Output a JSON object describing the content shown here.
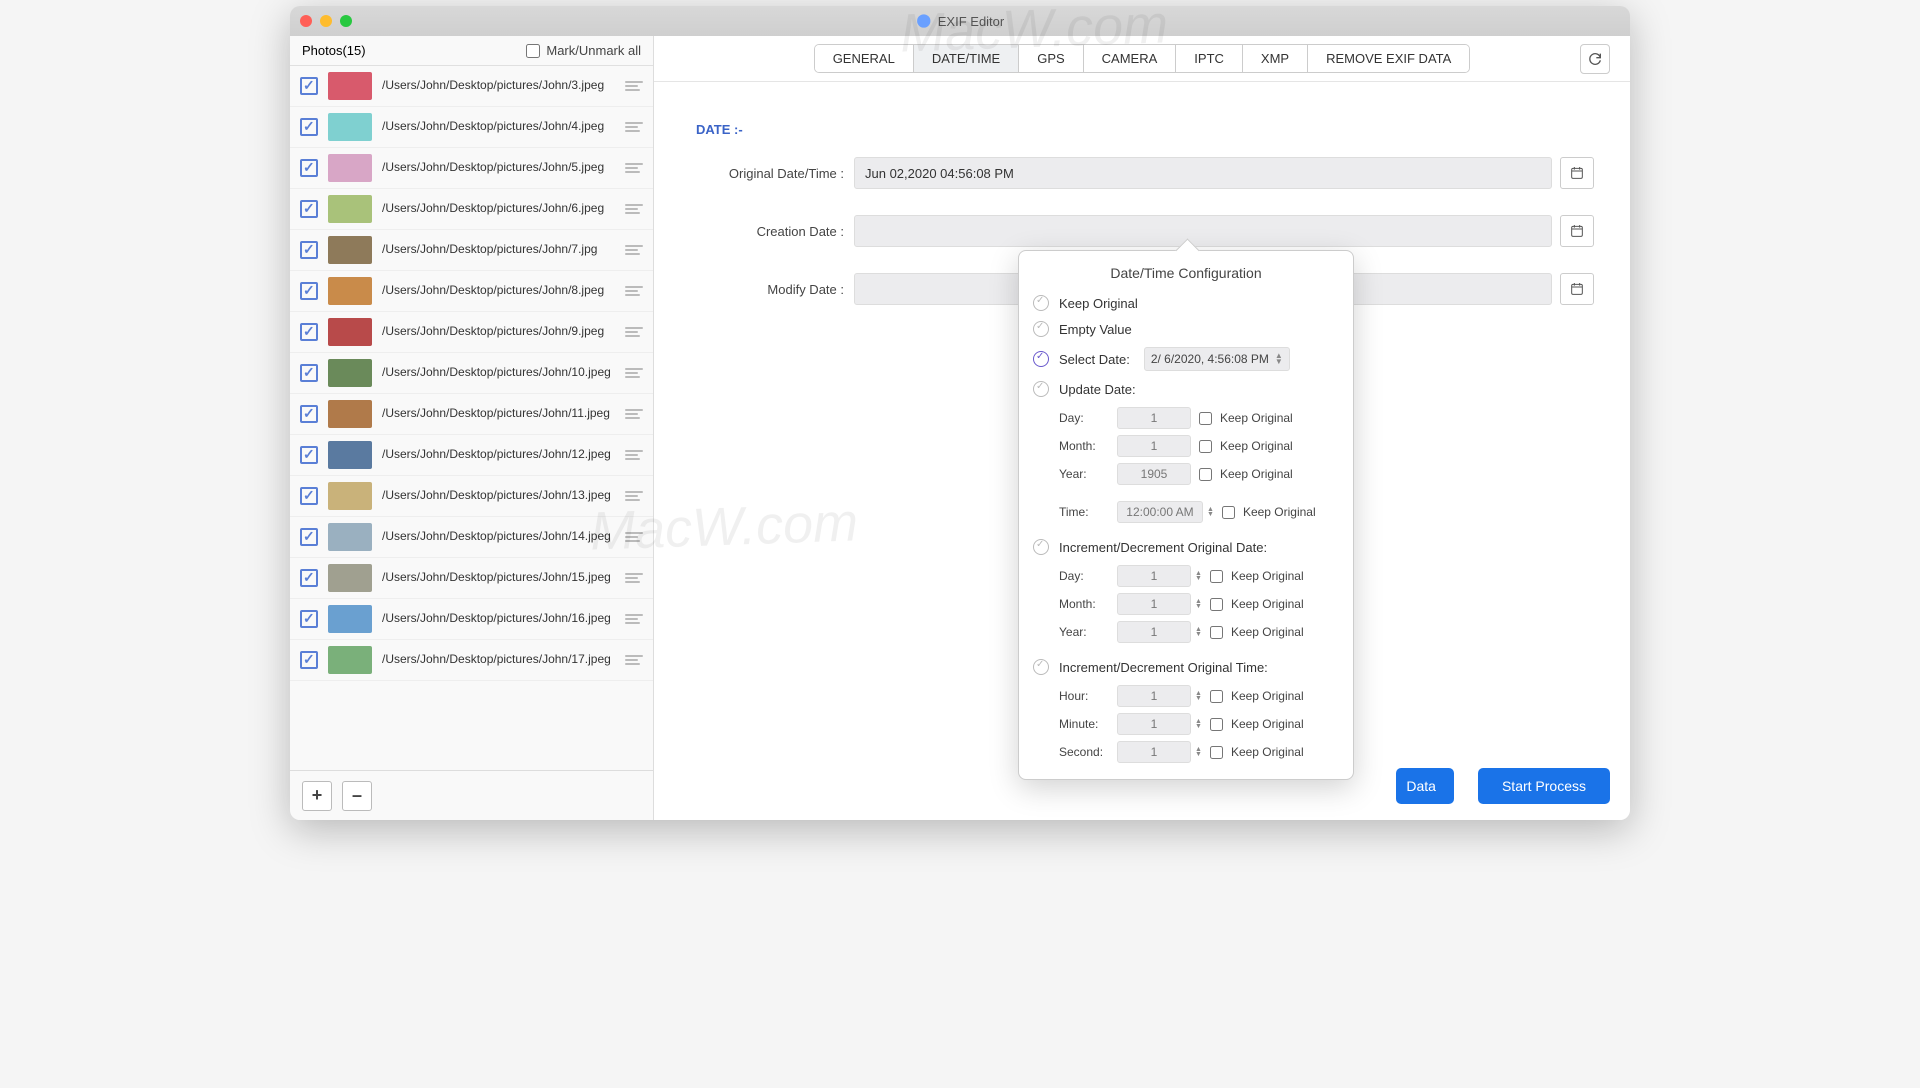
{
  "window": {
    "title": "EXIF Editor"
  },
  "sidebar": {
    "header": "Photos(15)",
    "mark_all_label": "Mark/Unmark all",
    "add_label": "+",
    "remove_label": "–",
    "items": [
      {
        "path": "/Users/John/Desktop/pictures/John/3.jpeg",
        "thumb_color": "#d85a6c"
      },
      {
        "path": "/Users/John/Desktop/pictures/John/4.jpeg",
        "thumb_color": "#7fd0d0"
      },
      {
        "path": "/Users/John/Desktop/pictures/John/5.jpeg",
        "thumb_color": "#d8a6c6"
      },
      {
        "path": "/Users/John/Desktop/pictures/John/6.jpeg",
        "thumb_color": "#a9c27a"
      },
      {
        "path": "/Users/John/Desktop/pictures/John/7.jpg",
        "thumb_color": "#8e7a5a"
      },
      {
        "path": "/Users/John/Desktop/pictures/John/8.jpeg",
        "thumb_color": "#c98b4a"
      },
      {
        "path": "/Users/John/Desktop/pictures/John/9.jpeg",
        "thumb_color": "#b84a4a"
      },
      {
        "path": "/Users/John/Desktop/pictures/John/10.jpeg",
        "thumb_color": "#6a8a5a"
      },
      {
        "path": "/Users/John/Desktop/pictures/John/11.jpeg",
        "thumb_color": "#b07a4a"
      },
      {
        "path": "/Users/John/Desktop/pictures/John/12.jpeg",
        "thumb_color": "#5a7aa0"
      },
      {
        "path": "/Users/John/Desktop/pictures/John/13.jpeg",
        "thumb_color": "#c9b27a"
      },
      {
        "path": "/Users/John/Desktop/pictures/John/14.jpeg",
        "thumb_color": "#9ab0c0"
      },
      {
        "path": "/Users/John/Desktop/pictures/John/15.jpeg",
        "thumb_color": "#a0a090"
      },
      {
        "path": "/Users/John/Desktop/pictures/John/16.jpeg",
        "thumb_color": "#6aa0d0"
      },
      {
        "path": "/Users/John/Desktop/pictures/John/17.jpeg",
        "thumb_color": "#7ab07a"
      }
    ]
  },
  "tabs": {
    "items": [
      "GENERAL",
      "DATE/TIME",
      "GPS",
      "CAMERA",
      "IPTC",
      "XMP",
      "REMOVE EXIF DATA"
    ],
    "active_index": 1
  },
  "date_panel": {
    "section": "DATE :-",
    "original_label": "Original Date/Time :",
    "original_value": "Jun 02,2020 04:56:08 PM",
    "creation_label": "Creation Date :",
    "creation_value": "",
    "modify_label": "Modify Date :",
    "modify_value": ""
  },
  "popover": {
    "title": "Date/Time Configuration",
    "keep_original": "Keep Original",
    "empty_value": "Empty Value",
    "select_date": "Select Date:",
    "select_date_value": "2/ 6/2020,   4:56:08 PM",
    "update_date": "Update Date:",
    "update": {
      "day_label": "Day:",
      "day_value": "1",
      "month_label": "Month:",
      "month_value": "1",
      "year_label": "Year:",
      "year_value": "1905",
      "time_label": "Time:",
      "time_value": "12:00:00 AM",
      "keep": "Keep Original"
    },
    "inc_date": "Increment/Decrement Original Date:",
    "incd": {
      "day_label": "Day:",
      "day_value": "1",
      "month_label": "Month:",
      "month_value": "1",
      "year_label": "Year:",
      "year_value": "1",
      "keep": "Keep Original"
    },
    "inc_time": "Increment/Decrement Original Time:",
    "inct": {
      "hour_label": "Hour:",
      "hour_value": "1",
      "minute_label": "Minute:",
      "minute_value": "1",
      "second_label": "Second:",
      "second_value": "1",
      "keep": "Keep Original"
    }
  },
  "footer": {
    "partial_button": "Data",
    "start_button": "Start Process"
  }
}
